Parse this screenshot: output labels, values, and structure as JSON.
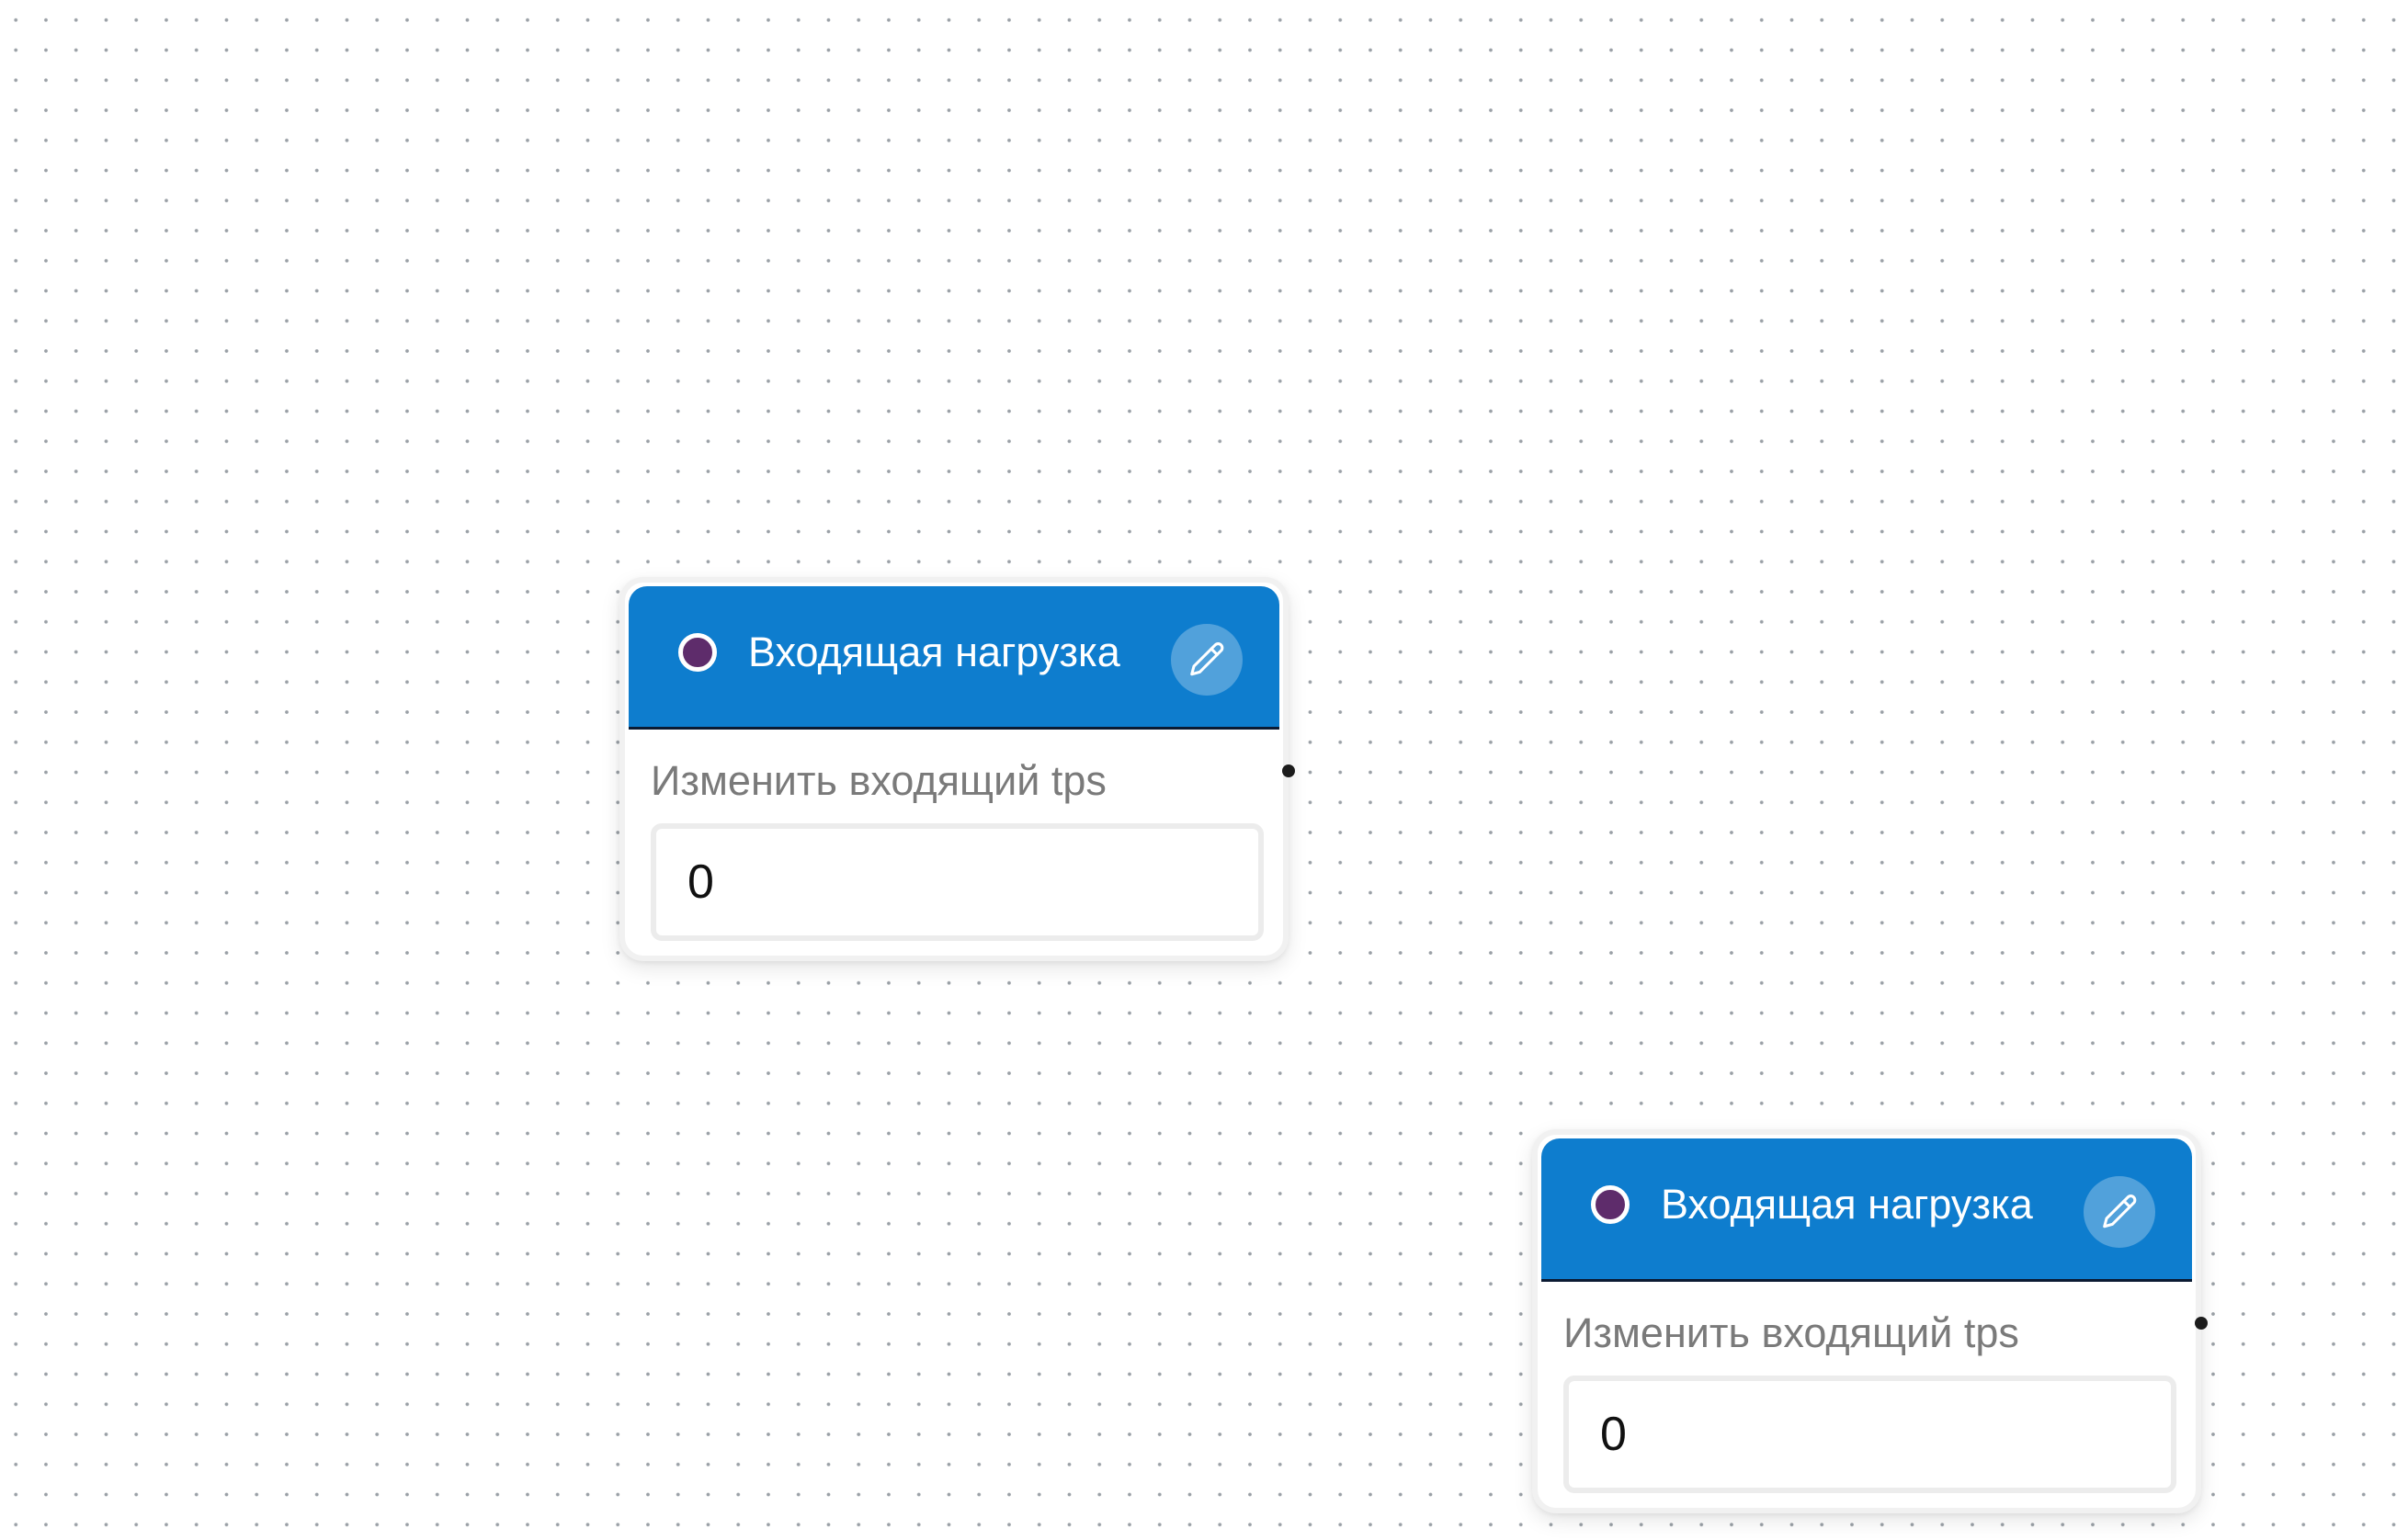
{
  "canvas": {
    "background": "#ffffff",
    "grid_dot_color": "#9aa0a6"
  },
  "nodes": [
    {
      "title": "Входящая нагрузка",
      "header_color": "#0e7dce",
      "status_color": "#5e2c6b",
      "edit_icon": "pencil-icon",
      "field_label": "Изменить входящий tps",
      "field_value": "0"
    },
    {
      "title": "Входящая нагрузка",
      "header_color": "#0e7dce",
      "status_color": "#5e2c6b",
      "edit_icon": "pencil-icon",
      "field_label": "Изменить входящий tps",
      "field_value": "0"
    }
  ]
}
